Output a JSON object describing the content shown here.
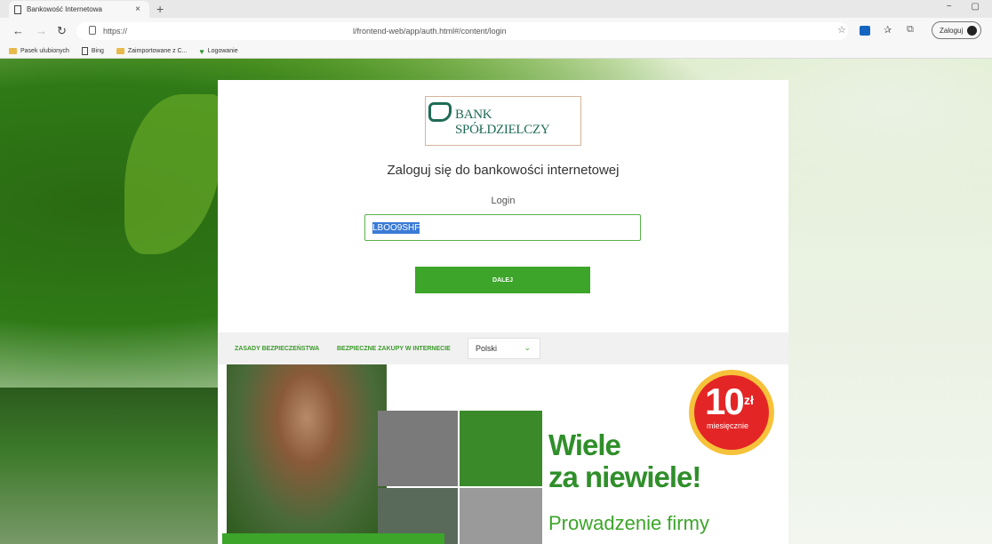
{
  "browser": {
    "tab_title": "Bankowość Internetowa",
    "tab_close": "×",
    "new_tab": "+",
    "window_minimize": "−",
    "window_restore": "▢",
    "url_scheme": "https://",
    "url_path": "l/frontend-web/app/auth.html#/content/login",
    "signin_label": "Zaloguj"
  },
  "favorites": [
    {
      "label": "Pasek ulubionych",
      "icon": "folder-icon"
    },
    {
      "label": "Bing",
      "icon": "page-icon"
    },
    {
      "label": "Zaimportowane z C...",
      "icon": "folder-icon"
    },
    {
      "label": "Logowanie",
      "icon": "heart-icon"
    }
  ],
  "login": {
    "bank_name": "BANK SPÓŁDZIELCZY",
    "heading": "Zaloguj się do bankowości internetowej",
    "field_label": "Login",
    "field_value": "LBOO9SHF",
    "button_label": "DALEJ"
  },
  "footer": {
    "link_security": "ZASADY BEZPIECZEŃSTWA",
    "link_shopping": "BEZPIECZNE ZAKUPY W INTERNECIE",
    "language": "Polski"
  },
  "ad": {
    "title_line1": "Wiele",
    "title_line2": "za niewiele!",
    "subtitle": "Prowadzenie firmy",
    "badge_amount": "10",
    "badge_currency": "zł",
    "badge_period": "miesięcznie"
  },
  "colors": {
    "accent_green": "#3ca52a",
    "bank_teal": "#1f6b57",
    "badge_red": "#e42526"
  }
}
